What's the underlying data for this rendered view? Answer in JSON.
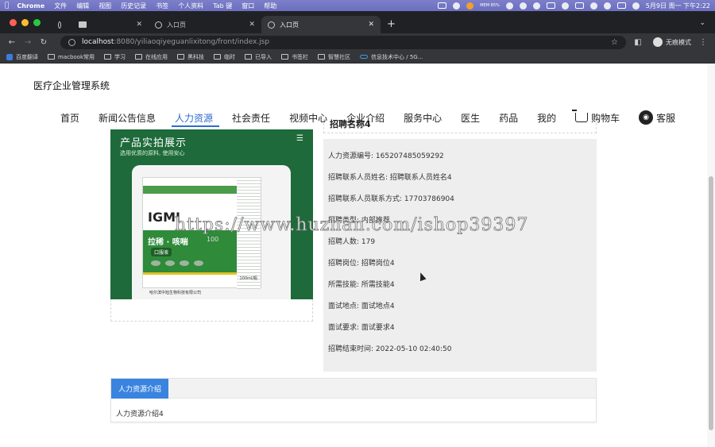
{
  "menubar": {
    "app": "Chrome",
    "items": [
      "文件",
      "编辑",
      "视图",
      "历史记录",
      "书签",
      "个人资料",
      "Tab 键",
      "窗口",
      "帮助"
    ],
    "mem": "MEM 85%",
    "clock": "5月9日 周一 下午2:22"
  },
  "tabs": [
    {
      "label": ""
    },
    {
      "label": ""
    },
    {
      "label": "入口页"
    },
    {
      "label": "入口页"
    }
  ],
  "address": {
    "host": "localhost",
    "path": ":8080/yiliaoqiyeguanlixitong/front/index.jsp",
    "incognito": "无痕模式"
  },
  "bookmarks": [
    "百度翻译",
    "macbook常用",
    "学习",
    "在线应用",
    "黑科技",
    "临时",
    "已导入",
    "书签栏",
    "智慧社区",
    "信息技术中心 / 5G..."
  ],
  "site": {
    "title": "医疗企业管理系统",
    "nav": [
      "首页",
      "新闻公告信息",
      "人力资源",
      "社会责任",
      "视频中心",
      "企业介绍",
      "服务中心",
      "医生",
      "药品",
      "我的"
    ],
    "cart": "购物车",
    "service": "客服"
  },
  "gallery": {
    "title": "产品实拍展示",
    "subtitle": "选用优质的原料, 使用安心",
    "brand": "IGMI",
    "product": "拉稀 · 咳喘",
    "product_suffix": "100",
    "sub_label": "口服液",
    "volume": "100ml/瓶",
    "maker": "哈尔滨中旭生物科技有限公司"
  },
  "detail": {
    "title": "招聘名称4",
    "rows": [
      "人力资源编号: 165207485059292",
      "招聘联系人员姓名: 招聘联系人员姓名4",
      "招聘联系人员联系方式: 17703786904",
      "招聘类型: 内部推荐",
      "招聘人数: 179",
      "招聘岗位: 招聘岗位4",
      "所需技能: 所需技能4",
      "面试地点: 面试地点4",
      "面试要求: 面试要求4",
      "招聘结束时间: 2022-05-10 02:40:50"
    ]
  },
  "intro": {
    "tab": "人力资源介绍",
    "content": "人力资源介绍4"
  },
  "watermark": "https://www.huzhan.com/ishop39397",
  "colors": {
    "accent": "#2d6bd0",
    "tab_blue": "#3a84e0",
    "menubar": "#7378c4"
  }
}
